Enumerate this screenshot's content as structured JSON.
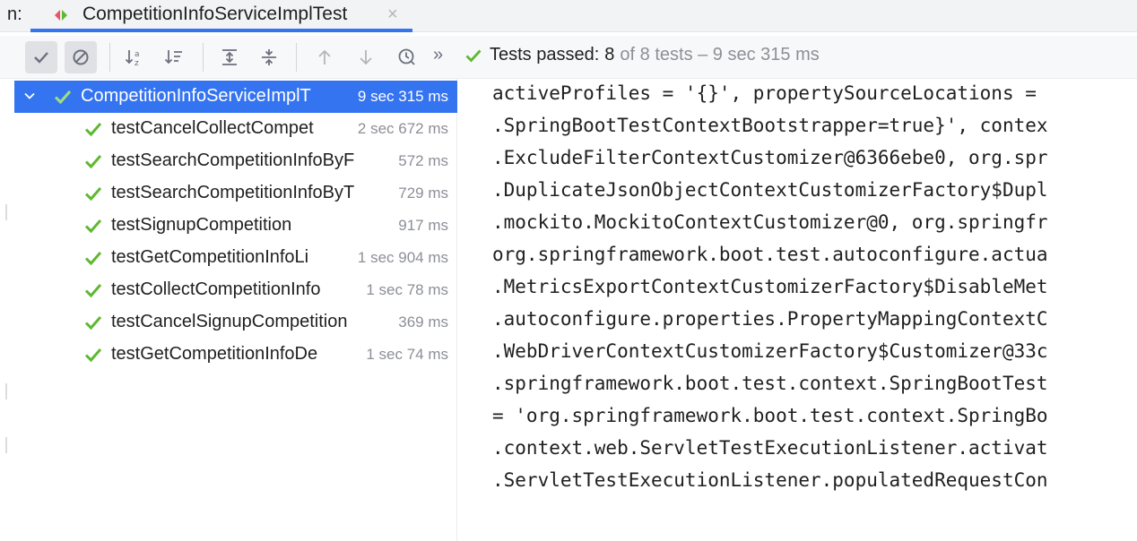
{
  "tabbar": {
    "run_label": "n:",
    "tab_title": "CompetitionInfoServiceImplTest",
    "close_glyph": "×",
    "accent": "#3574f0"
  },
  "toolbar": {
    "buttons": [
      {
        "icon": "check-icon",
        "glyph": "✓",
        "on": true
      },
      {
        "icon": "stop-circle-icon",
        "glyph": "⊘",
        "on": true
      },
      {
        "icon": "sort-alpha-icon",
        "glyph": "↓ª"
      },
      {
        "icon": "sort-duration-icon",
        "glyph": "↓≡"
      },
      {
        "icon": "expand-all-icon",
        "glyph": "⇕"
      },
      {
        "icon": "collapse-all-icon",
        "glyph": "⇳"
      },
      {
        "icon": "previous-arrow-icon",
        "glyph": "↑"
      },
      {
        "icon": "next-arrow-icon",
        "glyph": "↓"
      },
      {
        "icon": "history-clock-icon",
        "glyph": "⌚"
      }
    ],
    "overflow_glyph": "»",
    "status": {
      "label": "Tests passed:",
      "passed": "8",
      "rest": "of 8 tests – 9 sec 315 ms",
      "check_color": "#5fb832"
    }
  },
  "tree": {
    "root": {
      "name": "CompetitionInfoServiceImplT",
      "time": "9 sec 315 ms"
    },
    "items": [
      {
        "name": "testCancelCollectCompet",
        "time": "2 sec 672 ms"
      },
      {
        "name": "testSearchCompetitionInfoByF",
        "time": "572 ms"
      },
      {
        "name": "testSearchCompetitionInfoByT",
        "time": "729 ms"
      },
      {
        "name": "testSignupCompetition",
        "time": "917 ms"
      },
      {
        "name": "testGetCompetitionInfoLi",
        "time": "1 sec 904 ms"
      },
      {
        "name": "testCollectCompetitionInfo",
        "time": "1 sec 78 ms"
      },
      {
        "name": "testCancelSignupCompetition",
        "time": "369 ms"
      },
      {
        "name": "testGetCompetitionInfoDe",
        "time": "1 sec 74 ms"
      }
    ]
  },
  "console": {
    "lines": [
      "activeProfiles = '{}', propertySourceLocations = ",
      ".SpringBootTestContextBootstrapper=true}', contex",
      ".ExcludeFilterContextCustomizer@6366ebe0, org.spr",
      ".DuplicateJsonObjectContextCustomizerFactory$Dupl",
      ".mockito.MockitoContextCustomizer@0, org.springfr",
      "org.springframework.boot.test.autoconfigure.actua",
      ".MetricsExportContextCustomizerFactory$DisableMet",
      ".autoconfigure.properties.PropertyMappingContextC",
      ".WebDriverContextCustomizerFactory$Customizer@33c",
      ".springframework.boot.test.context.SpringBootTest",
      "= 'org.springframework.boot.test.context.SpringBo",
      ".context.web.ServletTestExecutionListener.activat",
      ".ServletTestExecutionListener.populatedRequestCon"
    ]
  }
}
